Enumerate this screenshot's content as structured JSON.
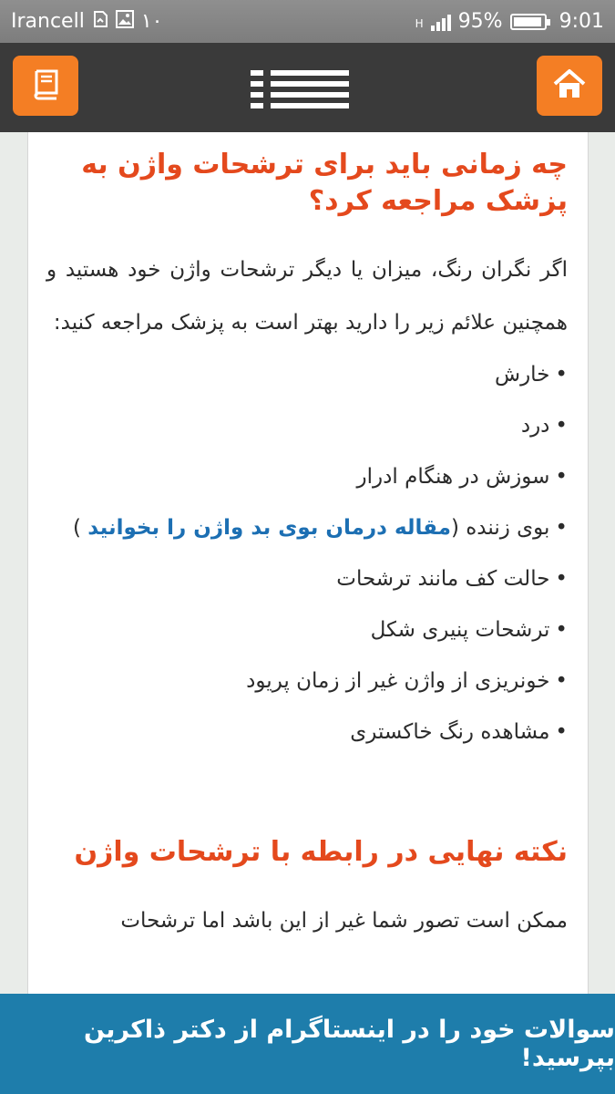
{
  "status_bar": {
    "carrier": "Irancell",
    "notification_count": "۱۰",
    "network_type": "H",
    "battery_percent": "95%",
    "battery_level": 0.95,
    "time": "9:01"
  },
  "header": {
    "colors": {
      "background": "#3a3a3a",
      "button": "#f47e24"
    },
    "icons": {
      "left": "book-icon",
      "center": "menu-list-icon",
      "right": "home-icon"
    }
  },
  "article": {
    "heading1": "چه زمانی باید برای ترشحات واژن به پزشک مراجعه کرد؟",
    "intro": "اگر نگران رنگ، میزان یا دیگر ترشحات واژن خود هستید و همچنین علائم زیر را دارید بهتر است به پزشک مراجعه کنید:",
    "items": [
      {
        "text": "خارش"
      },
      {
        "text": "درد"
      },
      {
        "text": "سوزش در هنگام ادرار"
      },
      {
        "text": "بوی زننده (",
        "link": "مقاله درمان بوی بد واژن را بخوانید",
        "after": " )"
      },
      {
        "text": "حالت کف مانند ترشحات"
      },
      {
        "text": "ترشحات پنیری شکل"
      },
      {
        "text": "خونریزی از واژن غیر از زمان پریود"
      },
      {
        "text": "مشاهده رنگ خاکستری"
      }
    ],
    "bullet": "•",
    "heading2": "نکته نهایی در رابطه با ترشحات واژن",
    "cut_text": "ممکن است تصور شما غیر از این باشد اما ترشحات"
  },
  "banner": {
    "text": "سوالات خود را در اینستاگرام از دکتر ذاکرین بپرسید!"
  }
}
